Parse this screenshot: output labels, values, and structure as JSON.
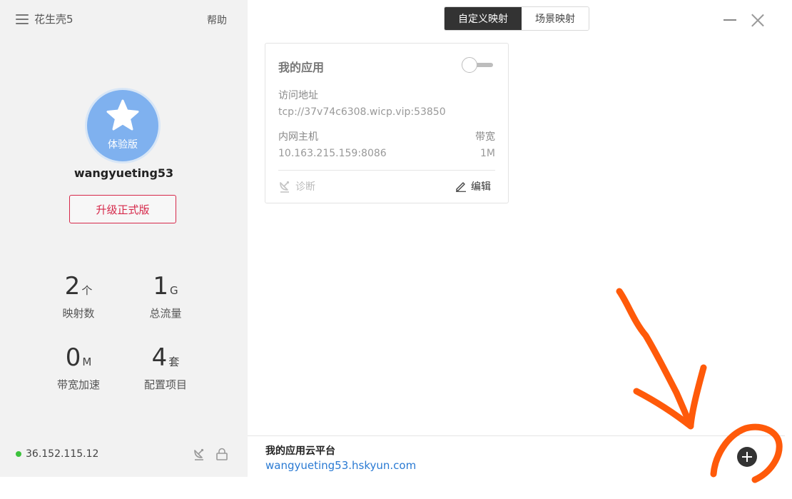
{
  "sidebar": {
    "app_title": "花生壳5",
    "help_label": "帮助",
    "avatar_badge": "体验版",
    "username": "wangyueting53",
    "upgrade_label": "升级正式版",
    "stats": [
      {
        "value": "2",
        "unit": "个",
        "label": "映射数"
      },
      {
        "value": "1",
        "unit": "G",
        "label": "总流量"
      },
      {
        "value": "0",
        "unit": "M",
        "label": "带宽加速"
      },
      {
        "value": "4",
        "unit": "套",
        "label": "配置项目"
      }
    ],
    "ip": "36.152.115.12",
    "status_color": "#3cc23c"
  },
  "tabs": [
    {
      "label": "自定义映射",
      "active": true
    },
    {
      "label": "场景映射",
      "active": false
    }
  ],
  "card": {
    "title": "我的应用",
    "enabled": false,
    "access_label": "访问地址",
    "access_value": "tcp://37v74c6308.wicp.vip:53850",
    "host_label": "内网主机",
    "host_value": "10.163.215.159:8086",
    "bandwidth_label": "带宽",
    "bandwidth_value": "1M",
    "diagnose_label": "诊断",
    "edit_label": "编辑"
  },
  "footer": {
    "cloud_title": "我的应用云平台",
    "cloud_link": "wangyueting53.hskyun.com"
  },
  "colors": {
    "accent_red": "#d6284a",
    "link_blue": "#2a7ad3",
    "annotation_orange": "#ff5a0a",
    "avatar_blue": "#7fb1ef"
  }
}
